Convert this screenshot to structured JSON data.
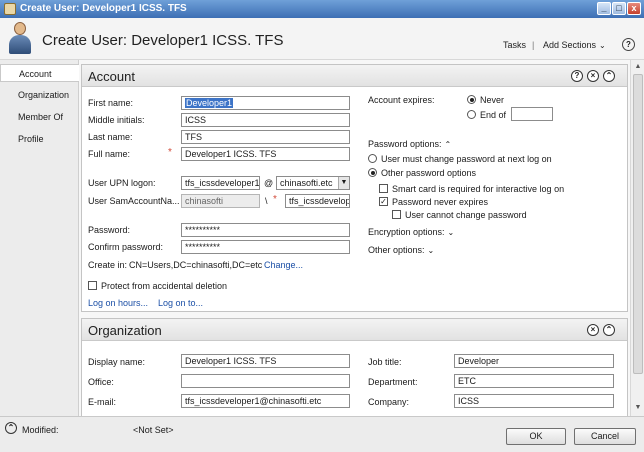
{
  "window": {
    "title": "Create User: Developer1 ICSS. TFS",
    "min": "_",
    "max": "□",
    "close": "x"
  },
  "header": {
    "title": "Create User: Developer1 ICSS. TFS",
    "tasks": "Tasks",
    "separator": "|",
    "add_sections": "Add Sections",
    "chevron": "⌄",
    "help": "?"
  },
  "nav": {
    "items": [
      "Account",
      "Organization",
      "Member Of",
      "Profile"
    ],
    "active": "Account"
  },
  "account": {
    "title": "Account",
    "first_name_label": "First name:",
    "first_name": "Developer1",
    "middle_initials_label": "Middle initials:",
    "middle_initials": "ICSS",
    "last_name_label": "Last name:",
    "last_name": "TFS",
    "full_name_label": "Full name:",
    "full_name": "Developer1 ICSS. TFS",
    "upn_label": "User UPN logon:",
    "upn": "tfs_icssdeveloper1",
    "at": "@",
    "domain": "chinasofti.etc",
    "sam_label": "User SamAccountNa...",
    "sam_domain": "chinasofti",
    "backslash": "\\",
    "sam": "tfs_icssdevelop",
    "password_label": "Password:",
    "password": "**********",
    "confirm_label": "Confirm password:",
    "confirm": "**********",
    "create_in_label": "Create in:",
    "create_in": "CN=Users,DC=chinasofti,DC=etc",
    "change_link": "Change...",
    "protect_label": "Protect from accidental deletion",
    "logon_hours": "Log on hours...",
    "logon_to": "Log on to...",
    "expires_label": "Account expires:",
    "never": "Never",
    "end_of": "End of",
    "password_options": "Password options:",
    "must_change": "User must change password at next log on",
    "other_pw_options": "Other password options",
    "smart_card": "Smart card is required for interactive log on",
    "never_expires": "Password never expires",
    "cannot_change": "User cannot change password",
    "encryption_options": "Encryption options:",
    "other_options": "Other options:",
    "required_mark": "*",
    "chevron_up": "⌃",
    "chevron_down": "⌄",
    "dd_arrow": "▼",
    "help": "?",
    "close": "×",
    "collapse": "⌃"
  },
  "organization": {
    "title": "Organization",
    "display_name_label": "Display name:",
    "display_name": "Developer1 ICSS. TFS",
    "office_label": "Office:",
    "office": "",
    "email_label": "E-mail:",
    "email": "tfs_icssdeveloper1@chinasofti.etc",
    "job_title_label": "Job title:",
    "job_title": "Developer",
    "department_label": "Department:",
    "department": "ETC",
    "company_label": "Company:",
    "company": "ICSS",
    "close": "×",
    "collapse": "⌃"
  },
  "status": {
    "modified_label": "Modified:",
    "modified_value": "<Not Set>",
    "ok": "OK",
    "cancel": "Cancel",
    "expand": "⌃"
  },
  "scroll": {
    "up": "▲",
    "down": "▼"
  },
  "colors": {
    "title_bar": "#3d6fb4",
    "selection": "#3d74c7",
    "required": "#d24b3a",
    "link": "#1b4fa6"
  }
}
